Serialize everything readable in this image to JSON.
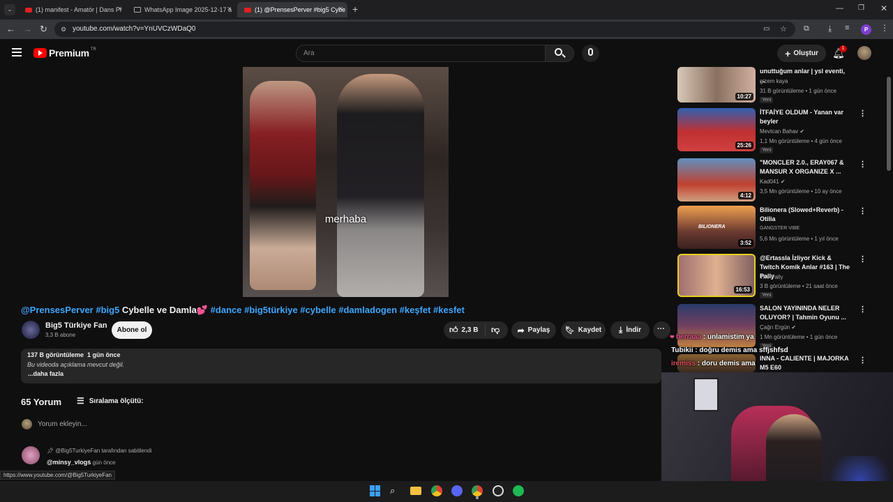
{
  "browser": {
    "tabs": [
      {
        "title": "(1) manifest - Amatör | Dans Pr",
        "active": false,
        "icon": "youtube"
      },
      {
        "title": "WhatsApp Image 2025-12-17 a",
        "active": false,
        "icon": "image"
      },
      {
        "title": "(1) @PrensesPerver #big5 Cybe",
        "active": true,
        "icon": "youtube"
      }
    ],
    "url": "youtube.com/watch?v=YnUVCzWDaQ0",
    "profile_initial": "P"
  },
  "yt": {
    "logo": "Premium",
    "region": "TR",
    "search_placeholder": "Ara",
    "create_label": "Oluştur",
    "notif_count": "1"
  },
  "video": {
    "subtitle": "merhaba",
    "title_prefix_tags": "@PrensesPerver #big5",
    "title_main": " Cybelle ve Damla💕 ",
    "title_suffix_tags": "#dance #big5türkiye #cybelle #damladogen #keşfet #kesfet",
    "channel": "Big5 Türkiye Fan",
    "subscribers": "3,3 B abone",
    "subscribe_label": "Abone ol",
    "likes": "2,3 B",
    "share_label": "Paylaş",
    "save_label": "Kaydet",
    "download_label": "İndir",
    "views_line": "137 B görüntüleme  1 gün önce",
    "description": "Bu videoda açıklama mevcut değil.",
    "more_label": "...daha fazla"
  },
  "comments": {
    "count_label": "65 Yorum",
    "sort_label": "Sıralama ölçütü:",
    "add_placeholder": "Yorum ekleyin...",
    "pinned_by": "@Big5TurkiyeFan tarafından sabitlendi",
    "first_author": "@minsy_vlogs",
    "first_time": "1 gün önce"
  },
  "status_url": "https://www.youtube.com/@Big5TurkiyeFan",
  "sidebar": {
    "items": [
      {
        "title": "unuttuğum anlar | ysl eventi, ...",
        "channel": "gizem kaya",
        "stats": "31 B görüntüleme • 1 gün önce",
        "badge": "Yeni",
        "duration": "10:27",
        "verified": false
      },
      {
        "title": "İTFAİYE OLDUM - Yanan var beyler",
        "channel": "Mevtcan Bahav",
        "stats": "1,1 Mn görüntüleme • 4 gün önce",
        "badge": "Yeni",
        "duration": "25:26",
        "verified": true
      },
      {
        "title": "\"MONCLER 2.0., ERAY067 & MANSUR X ORGANIZE X ...",
        "channel": "Kad041",
        "stats": "3,5 Mn görüntüleme • 10 ay önce",
        "badge": "",
        "duration": "4:12",
        "verified": true
      },
      {
        "title": "Bilionera (Slowed+Reverb) - Otilia",
        "channel": "GANGSTER VIBE",
        "stats": "5,6 Mn görüntüleme • 1 yıl önce",
        "badge": "",
        "duration": "3:52",
        "verified": false
      },
      {
        "title": "@Ertassla İzliyor Kick & Twitch Komik Anlar #163 | The Pally",
        "channel": "The Pally",
        "stats": "3 B görüntüleme • 21 saat önce",
        "badge": "Yeni",
        "duration": "16:53",
        "verified": false
      },
      {
        "title": "SALON YAYININDA NELER OLUYOR? | Tahmin Oyunu ...",
        "channel": "Çağrı Ergün",
        "stats": "1 Mn görüntüleme • 1 gün önce",
        "badge": "Yeni",
        "duration": "",
        "verified": true
      },
      {
        "title": "INNA - CALIENTE | MAJORKA M5 E60",
        "channel": "",
        "stats": "",
        "badge": "",
        "duration": "",
        "verified": false
      }
    ]
  },
  "overlay_chat": [
    {
      "user": "berraaa",
      "text": "unlamistim ya",
      "user_color": "#e0508a"
    },
    {
      "user": "Tubikii",
      "text": "doğru demis ama sffjshfsd",
      "user_color": "#ffffff"
    },
    {
      "user": "iremiss",
      "text": "doru demis ama",
      "user_color": "#e05060"
    }
  ],
  "colors": {
    "background": "#0f0f0f",
    "accent_link": "#3ea6ff",
    "youtube_red": "#ff0000"
  }
}
